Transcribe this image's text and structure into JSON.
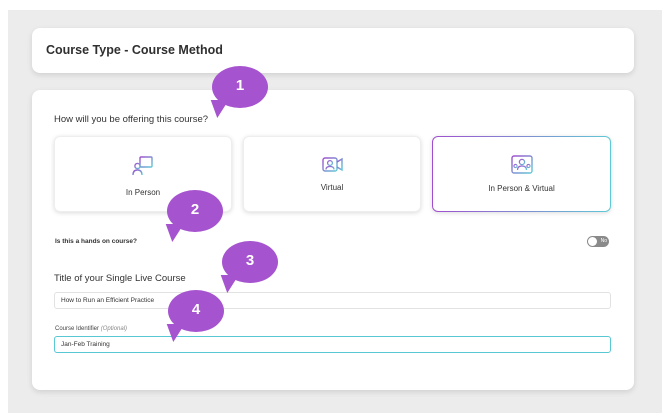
{
  "header": {
    "title": "Course Type - Course Method"
  },
  "offering": {
    "question": "How will you be offering this course?",
    "options": [
      {
        "label": "In Person",
        "icon": "presenter-icon",
        "selected": false
      },
      {
        "label": "Virtual",
        "icon": "video-conference-icon",
        "selected": false
      },
      {
        "label": "In Person & Virtual",
        "icon": "hybrid-meeting-icon",
        "selected": true
      }
    ]
  },
  "hands_on": {
    "label": "Is this a hands on course?",
    "toggle_text": "No",
    "value": false
  },
  "course_title": {
    "section_label": "Title of your Single Live Course",
    "value": "How to Run an Efficient Practice"
  },
  "course_identifier": {
    "label": "Course Identifier",
    "optional_text": "(Optional)",
    "value": "Jan-Feb Training"
  },
  "annotations": [
    "1",
    "2",
    "3",
    "4"
  ],
  "colors": {
    "accent_purple": "#a653cf",
    "accent_teal": "#57c8d4",
    "background": "#ececec"
  }
}
